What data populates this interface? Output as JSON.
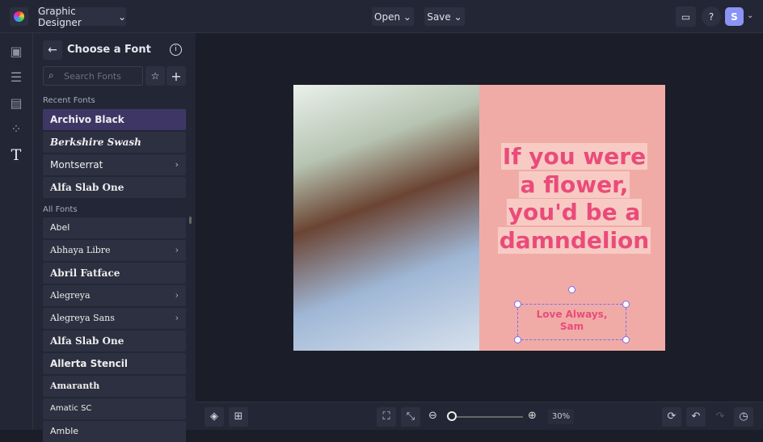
{
  "header": {
    "workspace": "Graphic Designer",
    "open": "Open",
    "save": "Save",
    "avatar": "S"
  },
  "panel": {
    "title": "Choose a Font",
    "search_placeholder": "Search Fonts",
    "recent_label": "Recent Fonts",
    "all_label": "All Fonts",
    "recent": [
      {
        "label": "Archivo Black"
      },
      {
        "label": "Berkshire Swash"
      },
      {
        "label": "Montserrat",
        "chev": "›"
      },
      {
        "label": "Alfa Slab One"
      }
    ],
    "all": [
      {
        "label": "Abel"
      },
      {
        "label": "Abhaya Libre",
        "chev": "›"
      },
      {
        "label": "Abril Fatface"
      },
      {
        "label": "Alegreya",
        "chev": "›"
      },
      {
        "label": "Alegreya Sans",
        "chev": "›"
      },
      {
        "label": "Alfa Slab One"
      },
      {
        "label": "Allerta Stencil"
      },
      {
        "label": "Amaranth"
      },
      {
        "label": "Amatic SC"
      },
      {
        "label": "Amble"
      }
    ]
  },
  "canvas": {
    "headline": [
      "If you were",
      "a flower,",
      "you'd be a",
      "damndelion"
    ],
    "signoff": [
      "Love Always,",
      "Sam"
    ]
  },
  "footer": {
    "zoom": "30%",
    "zoom_value": 30
  },
  "colors": {
    "accent": "#3e3766",
    "headline": "#ea4b7a"
  }
}
